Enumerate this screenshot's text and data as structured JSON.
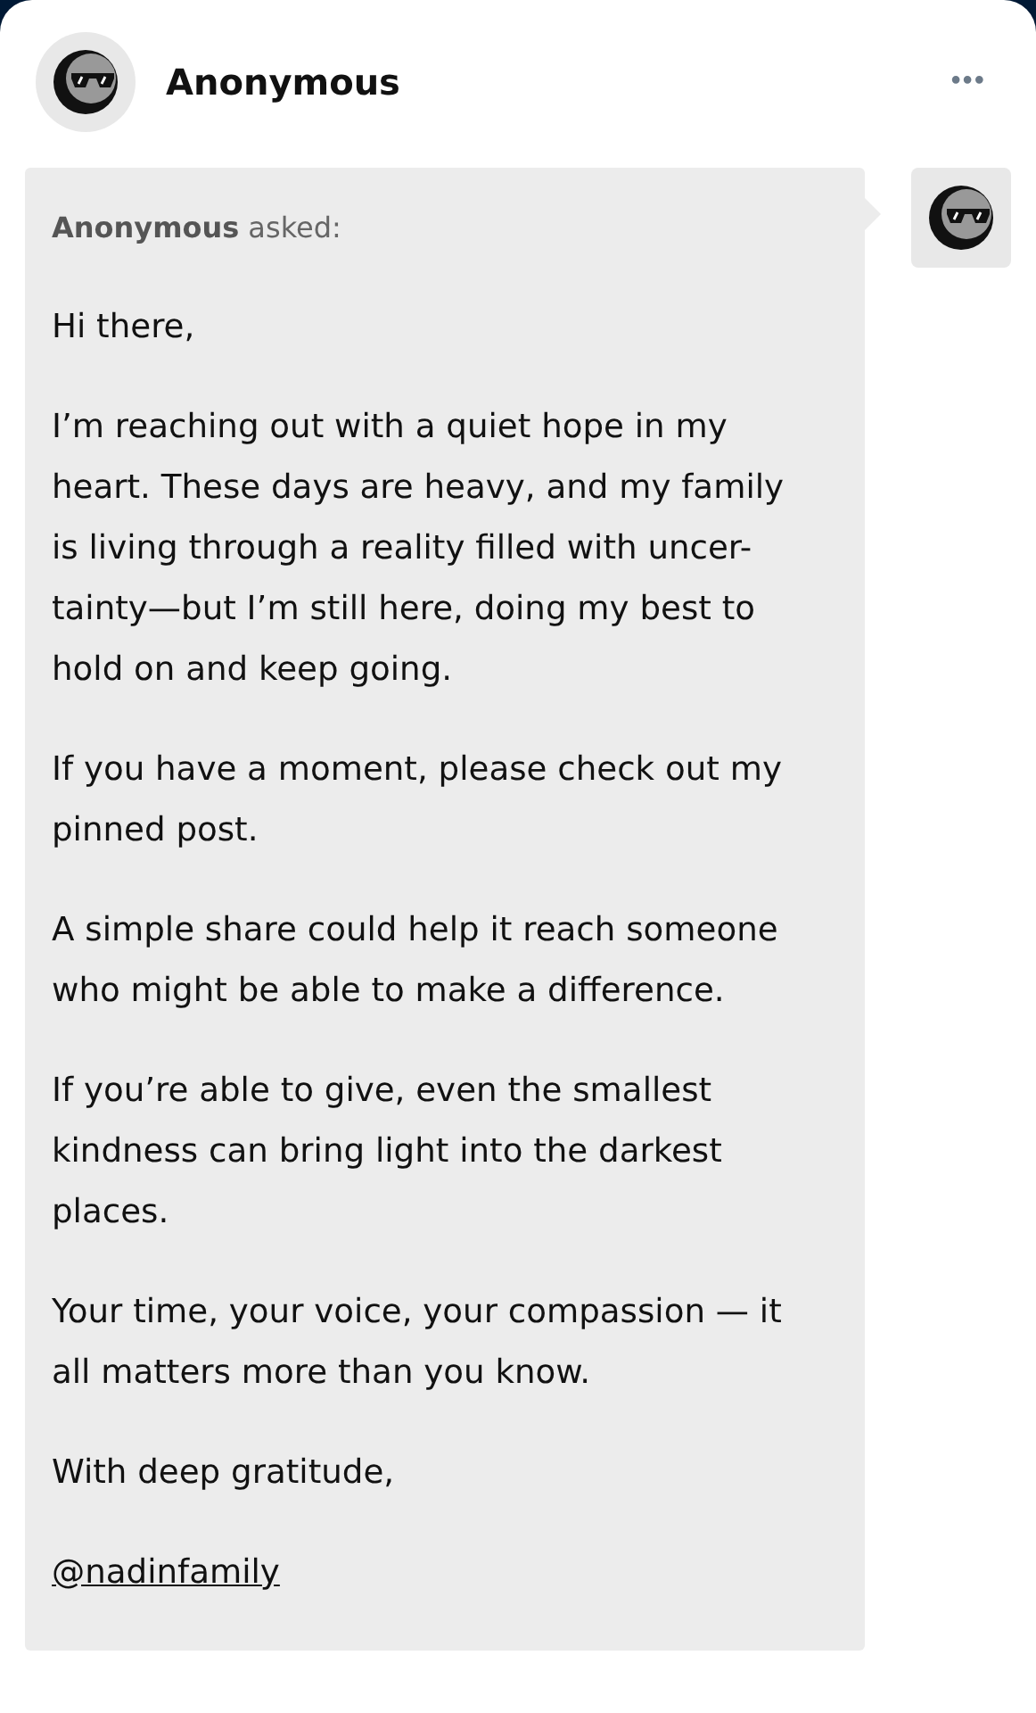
{
  "post": {
    "author": "Anonymous",
    "menu": "•••"
  },
  "ask": {
    "asker": "Anonymous",
    "asked_label": "asked:",
    "paragraphs": [
      {
        "kind": "text",
        "text": "Hi there,"
      },
      {
        "kind": "text",
        "text": "I’m reaching out with a quiet hope in my\nheart. These days are heavy, and my family\nis living through a reality filled with uncer-\ntainty—but I’m still here, doing my best to\nhold on and keep going."
      },
      {
        "kind": "text",
        "text": "If you have a moment, please check out my\npinned post."
      },
      {
        "kind": "text",
        "text": "A simple share could help it reach someone\nwho might be able to make a difference."
      },
      {
        "kind": "text",
        "text": "If you’re able to give, even the smallest\nkindness can bring light into the darkest\nplaces."
      },
      {
        "kind": "text",
        "text": "Your time, your voice, your compassion — it\nall matters more than you know."
      },
      {
        "kind": "text",
        "text": "With deep gratitude,"
      },
      {
        "kind": "link",
        "text": "@nadinfamily"
      }
    ]
  }
}
